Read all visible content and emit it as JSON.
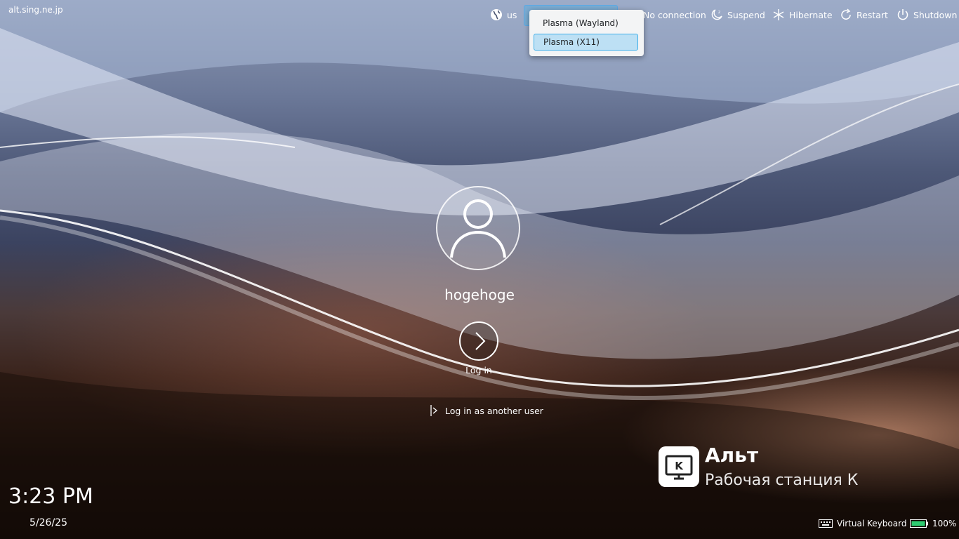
{
  "hostname": "alt.sing.ne.jp",
  "toolbar": {
    "keyboard_layout": "us",
    "network": "No connection",
    "suspend": "Suspend",
    "hibernate": "Hibernate",
    "restart": "Restart",
    "shutdown": "Shutdown"
  },
  "session_menu": {
    "options": [
      "Plasma (Wayland)",
      "Plasma (X11)"
    ],
    "selected": "Plasma (X11)"
  },
  "user": {
    "name": "hogehoge",
    "login_label": "Log in",
    "other_user": "Log in as another user"
  },
  "clock": {
    "time": "3:23 PM",
    "date": "5/26/25"
  },
  "brand": {
    "name": "Альт",
    "subtitle": "Рабочая станция К"
  },
  "footer": {
    "virtual_keyboard": "Virtual Keyboard",
    "battery": "100%"
  },
  "colors": {
    "accent": "#3daee9",
    "popup_bg": "#f3f4f5",
    "selected_bg": "#bde0f4"
  },
  "icons": {
    "globe": "globe-icon",
    "network": "network-icon",
    "suspend": "suspend-moon-icon",
    "hibernate": "snowflake-icon",
    "restart": "restart-icon",
    "shutdown": "power-icon",
    "avatar": "user-avatar-icon",
    "login": "chevron-right-icon",
    "other_user": "login-arrow-icon",
    "keyboard": "keyboard-icon",
    "battery": "battery-icon"
  }
}
